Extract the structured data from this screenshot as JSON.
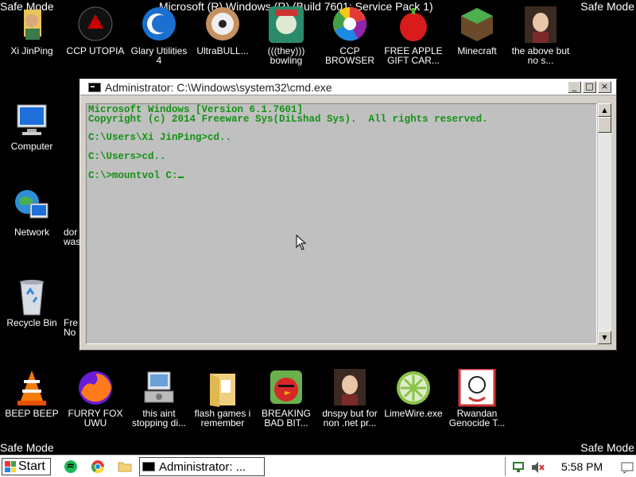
{
  "watermark": {
    "safe_mode_tl": "Safe Mode",
    "safe_mode_tr": "Safe Mode",
    "safe_mode_bl": "Safe Mode",
    "safe_mode_br": "Safe Mode",
    "build": "Microsoft (R) Windows (R) (Build 7601: Service Pack 1)"
  },
  "desktop": {
    "top_row": [
      {
        "label": "Xi JinPing",
        "icon": "person-icon"
      },
      {
        "label": "CCP UTOPIA",
        "icon": "red-emblem-icon"
      },
      {
        "label": "Glary Utilities 4",
        "icon": "glary-icon"
      },
      {
        "label": "UltraBULL...",
        "icon": "disc-icon"
      },
      {
        "label": "(((they))) bowling",
        "icon": "cartoon-icon"
      },
      {
        "label": "CCP BROWSER",
        "icon": "browser-icon"
      },
      {
        "label": "FREE APPLE GIFT CAR...",
        "icon": "apple-icon"
      },
      {
        "label": "Minecraft",
        "icon": "minecraft-icon"
      },
      {
        "label": "the above but no s...",
        "icon": "portrait-icon"
      }
    ],
    "left_col": [
      {
        "label": "Computer",
        "icon": "computer-icon"
      },
      {
        "label": "Network",
        "icon": "network-icon"
      },
      {
        "label": "Recycle Bin",
        "icon": "recycle-bin-icon"
      }
    ],
    "partial": [
      {
        "label": "dor was"
      },
      {
        "label": "Fre No"
      }
    ],
    "bottom_row": [
      {
        "label": "BEEP BEEP",
        "icon": "vlc-icon"
      },
      {
        "label": "FURRY FOX UWU",
        "icon": "firefox-icon"
      },
      {
        "label": "this aint stopping di...",
        "icon": "installer-icon"
      },
      {
        "label": "flash games i remember",
        "icon": "folder-icon"
      },
      {
        "label": "BREAKING BAD BIT...",
        "icon": "angry-bird-icon"
      },
      {
        "label": "dnspy but for non .net pr...",
        "icon": "portrait-icon"
      },
      {
        "label": "LimeWire.exe",
        "icon": "limewire-icon"
      },
      {
        "label": "Rwandan Genocide T...",
        "icon": "meme-icon"
      }
    ]
  },
  "cmd": {
    "title": "Administrator: C:\\Windows\\system32\\cmd.exe",
    "lines": [
      "Microsoft Windows [Version 6.1.7601]",
      "Copyright (c) 2014 Freeware Sys(DiLshad Sys).  All rights reserved.",
      "",
      "C:\\Users\\Xi JinPing>cd..",
      "",
      "C:\\Users>cd..",
      "",
      "C:\\>mountvol C:"
    ],
    "colors": {
      "text": "#149214",
      "background": "#c0c0c0"
    }
  },
  "taskbar": {
    "start_label": "Start",
    "task_label": "Administrator: ...",
    "clock": "5:58 PM"
  }
}
